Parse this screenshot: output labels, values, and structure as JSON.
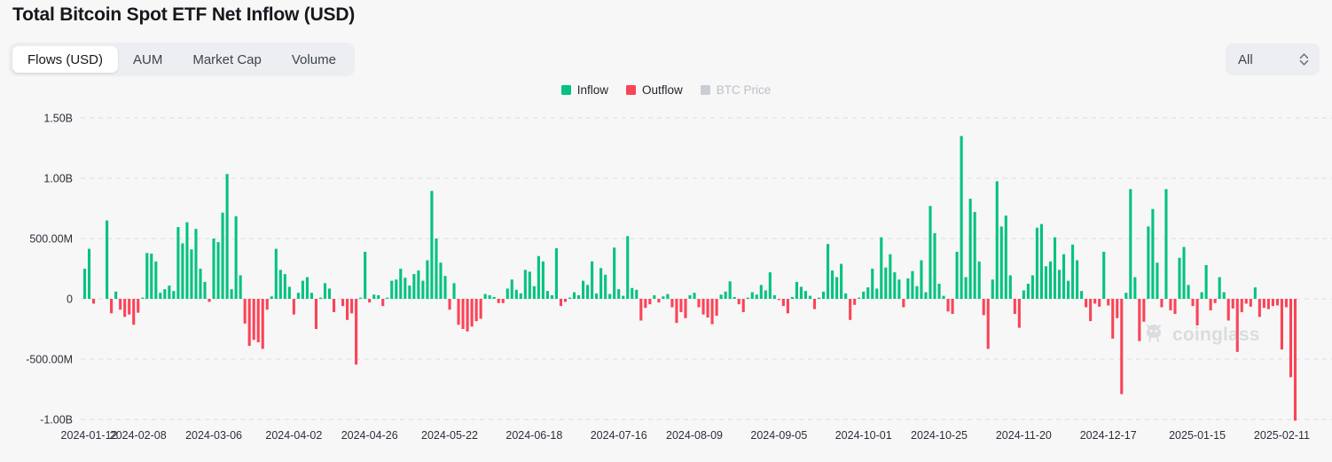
{
  "header": {
    "title": "Total Bitcoin Spot ETF Net Inflow (USD)"
  },
  "tabs": [
    {
      "label": "Flows (USD)",
      "active": true
    },
    {
      "label": "AUM",
      "active": false
    },
    {
      "label": "Market Cap",
      "active": false
    },
    {
      "label": "Volume",
      "active": false
    }
  ],
  "range_select": {
    "value": "All",
    "icon": "stepper-chevron-icon"
  },
  "legend": [
    {
      "label": "Inflow",
      "color": "#05c27f",
      "disabled": false
    },
    {
      "label": "Outflow",
      "color": "#fa4457",
      "disabled": false
    },
    {
      "label": "BTC Price",
      "color": "#c9ced4",
      "disabled": true
    }
  ],
  "watermark": {
    "text": "coinglass",
    "icon": "coinglass-logo-icon"
  },
  "chart_data": {
    "type": "bar",
    "title": "Total Bitcoin Spot ETF Net Inflow (USD)",
    "xlabel": "",
    "ylabel": "",
    "ylim": [
      -1000000000,
      1500000000
    ],
    "grid": true,
    "legend_position": "top-center",
    "y_ticks": [
      {
        "value": 1500000000,
        "label": "1.50B"
      },
      {
        "value": 1000000000,
        "label": "1.00B"
      },
      {
        "value": 500000000,
        "label": "500.00M"
      },
      {
        "value": 0,
        "label": "0"
      },
      {
        "value": -500000000,
        "label": "-500.00M"
      },
      {
        "value": -1000000000,
        "label": "-1.00B"
      }
    ],
    "x_ticks": [
      "2024-01-12",
      "2024-02-08",
      "2024-03-06",
      "2024-04-02",
      "2024-04-26",
      "2024-05-22",
      "2024-06-18",
      "2024-07-16",
      "2024-08-09",
      "2024-09-05",
      "2024-10-01",
      "2024-10-25",
      "2024-11-20",
      "2024-12-17",
      "2025-01-15",
      "2025-02-11"
    ],
    "x_tick_indices": [
      1,
      12,
      29,
      47,
      64,
      82,
      101,
      120,
      137,
      156,
      175,
      192,
      211,
      230,
      250,
      269
    ],
    "series": [
      {
        "name": "Net Inflow",
        "unit": "USD",
        "positive_color": "#05c27f",
        "negative_color": "#fa4457",
        "values": [
          250000000,
          415000000,
          -40000000,
          0,
          0,
          650000000,
          -120000000,
          60000000,
          -90000000,
          -150000000,
          -130000000,
          -215000000,
          -115000000,
          10000000,
          380000000,
          375000000,
          310000000,
          50000000,
          80000000,
          110000000,
          65000000,
          595000000,
          460000000,
          635000000,
          410000000,
          580000000,
          250000000,
          140000000,
          -25000000,
          500000000,
          470000000,
          715000000,
          1035000000,
          80000000,
          685000000,
          195000000,
          -205000000,
          -390000000,
          -340000000,
          -360000000,
          -415000000,
          -90000000,
          20000000,
          415000000,
          240000000,
          205000000,
          100000000,
          -130000000,
          50000000,
          150000000,
          180000000,
          50000000,
          -250000000,
          10000000,
          130000000,
          85000000,
          -110000000,
          0,
          -60000000,
          -175000000,
          -120000000,
          -545000000,
          10000000,
          390000000,
          -30000000,
          35000000,
          30000000,
          -60000000,
          10000000,
          150000000,
          160000000,
          250000000,
          175000000,
          110000000,
          205000000,
          235000000,
          150000000,
          320000000,
          895000000,
          500000000,
          300000000,
          190000000,
          -90000000,
          130000000,
          -215000000,
          -250000000,
          -270000000,
          -230000000,
          -185000000,
          -165000000,
          40000000,
          30000000,
          15000000,
          -35000000,
          -35000000,
          85000000,
          160000000,
          75000000,
          45000000,
          240000000,
          225000000,
          105000000,
          355000000,
          310000000,
          65000000,
          30000000,
          420000000,
          -60000000,
          -25000000,
          10000000,
          55000000,
          30000000,
          150000000,
          115000000,
          310000000,
          45000000,
          255000000,
          200000000,
          40000000,
          425000000,
          80000000,
          25000000,
          520000000,
          90000000,
          75000000,
          -180000000,
          -75000000,
          -45000000,
          30000000,
          -30000000,
          20000000,
          40000000,
          -70000000,
          -200000000,
          -110000000,
          -160000000,
          30000000,
          50000000,
          -70000000,
          -130000000,
          -155000000,
          -210000000,
          -140000000,
          35000000,
          60000000,
          145000000,
          15000000,
          -45000000,
          -110000000,
          10000000,
          55000000,
          35000000,
          115000000,
          70000000,
          220000000,
          30000000,
          -10000000,
          -60000000,
          -120000000,
          15000000,
          140000000,
          100000000,
          65000000,
          25000000,
          -85000000,
          10000000,
          60000000,
          455000000,
          235000000,
          180000000,
          290000000,
          45000000,
          -175000000,
          -50000000,
          10000000,
          60000000,
          95000000,
          250000000,
          85000000,
          510000000,
          260000000,
          370000000,
          220000000,
          160000000,
          -70000000,
          170000000,
          230000000,
          105000000,
          320000000,
          55000000,
          770000000,
          545000000,
          125000000,
          25000000,
          -105000000,
          -125000000,
          390000000,
          1350000000,
          180000000,
          830000000,
          720000000,
          310000000,
          -135000000,
          -415000000,
          160000000,
          975000000,
          600000000,
          690000000,
          195000000,
          -125000000,
          -240000000,
          70000000,
          125000000,
          195000000,
          590000000,
          620000000,
          270000000,
          310000000,
          510000000,
          240000000,
          370000000,
          150000000,
          450000000,
          320000000,
          65000000,
          -70000000,
          -185000000,
          -40000000,
          -65000000,
          390000000,
          -55000000,
          -330000000,
          -160000000,
          -790000000,
          50000000,
          910000000,
          180000000,
          -350000000,
          -190000000,
          600000000,
          745000000,
          300000000,
          -70000000,
          910000000,
          -95000000,
          -125000000,
          340000000,
          430000000,
          115000000,
          -60000000,
          -220000000,
          55000000,
          280000000,
          -95000000,
          -35000000,
          180000000,
          55000000,
          -180000000,
          -80000000,
          -440000000,
          -110000000,
          -40000000,
          -65000000,
          95000000,
          -150000000,
          -75000000,
          -85000000,
          -60000000,
          -55000000,
          -420000000,
          -70000000,
          -650000000,
          -1010000000
        ]
      }
    ]
  }
}
